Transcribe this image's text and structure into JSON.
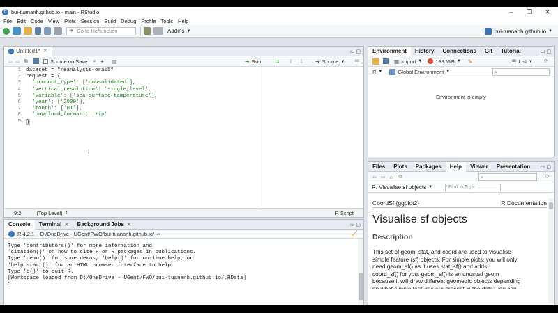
{
  "window": {
    "title": "bui-tuananh.github.io - main - RStudio",
    "minimize": "–",
    "maximize": "❐",
    "close": "✕"
  },
  "menu": [
    "File",
    "Edit",
    "Code",
    "View",
    "Plots",
    "Session",
    "Build",
    "Debug",
    "Profile",
    "Tools",
    "Help"
  ],
  "toolbar": {
    "goto_placeholder": "Go to file/function",
    "addins_label": "Addins",
    "project_label": "bui-tuananh.github.io"
  },
  "editor": {
    "tab_label": "Untitled1*",
    "source_on_save": "Source on Save",
    "run_label": "Run",
    "source_label": "Source",
    "line_numbers": [
      "1",
      "2",
      "3",
      "4",
      "5",
      "6",
      "7",
      "8",
      "9"
    ],
    "lines": [
      "dataset = \"reanalysis-oras5\"",
      "request = {",
      "  'product_type': ['consolidated'],",
      "  'vertical_resolution': 'single_level',",
      "  'variable': ['sea_surface_temperature'],",
      "  'year': ['2000'],",
      "  'month': ['01'],",
      "  'download_format': 'zip'",
      "}"
    ],
    "status_position": "9:2",
    "status_scope": "(Top Level)",
    "status_type": "R Script"
  },
  "console": {
    "tabs": [
      "Console",
      "Terminal",
      "Background Jobs"
    ],
    "r_version": "R 4.2.1",
    "path": "D:/OneDrive - UGent/FWO/bui-tuananh.github.io/",
    "lines": [
      "Type 'contributors()' for more information and",
      "'citation()' on how to cite R or R packages in publications.",
      "",
      "Type 'demo()' for some demos, 'help()' for on-line help, or",
      "'help.start()' for an HTML browser interface to help.",
      "Type 'q()' to quit R.",
      "",
      "[Workspace loaded from D:/OneDrive - UGent/FWO/bui-tuananh.github.io/.RData]",
      "",
      ">"
    ]
  },
  "environment": {
    "tabs": [
      "Environment",
      "History",
      "Connections",
      "Git",
      "Tutorial"
    ],
    "import_label": "Import",
    "memory_label": "139 MiB",
    "list_label": "List",
    "lang_label": "R",
    "scope_label": "Global Environment",
    "empty_message": "Environment is empty"
  },
  "help": {
    "tabs": [
      "Files",
      "Plots",
      "Packages",
      "Help",
      "Viewer",
      "Presentation"
    ],
    "topic_title": "R: Visualise sf objects",
    "find_placeholder": "Find in Topic",
    "header_left": "CoordSf {ggplot2}",
    "header_right": "R Documentation",
    "page_title": "Visualise sf objects",
    "section_title": "Description",
    "description_lines": [
      "This set of geom, stat, and coord are used to visualise",
      "simple feature (sf) objects. For simple plots, you will only",
      "need geom_sf() as it uses stat_sf() and adds",
      "coord_sf() for you. geom_sf() is an unusual geom",
      "because it will draw different geometric objects depending",
      "on what simple features are present in the data: you can"
    ]
  },
  "colors": {
    "accent": "#3b73b9",
    "string": "#1a7d1a",
    "chrome": "#dfe3e8"
  }
}
